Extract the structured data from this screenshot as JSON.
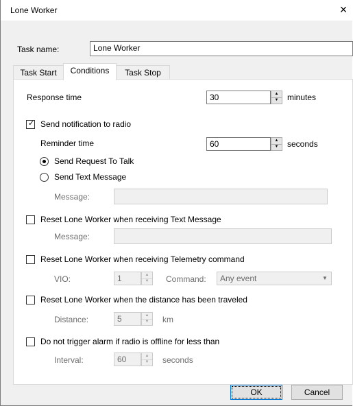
{
  "window": {
    "title": "Lone Worker",
    "close_glyph": "×"
  },
  "task_name": {
    "label": "Task name:",
    "value": "Lone Worker"
  },
  "tabs": [
    {
      "label": "Task Start",
      "active": false
    },
    {
      "label": "Conditions",
      "active": true
    },
    {
      "label": "Task Stop",
      "active": false
    }
  ],
  "conditions": {
    "response_time": {
      "label": "Response time",
      "value": "30",
      "unit": "minutes"
    },
    "send_notification": {
      "label": "Send notification to radio",
      "checked": true
    },
    "reminder_time": {
      "label": "Reminder time",
      "value": "60",
      "unit": "seconds"
    },
    "send_request_to_talk": {
      "label": "Send Request To Talk",
      "selected": true
    },
    "send_text_message": {
      "label": "Send Text Message",
      "selected": false
    },
    "message1": {
      "label": "Message:",
      "value": ""
    },
    "reset_text_message": {
      "label": "Reset Lone Worker when receiving Text Message",
      "checked": false
    },
    "message2": {
      "label": "Message:",
      "value": ""
    },
    "reset_telemetry": {
      "label": "Reset Lone Worker when receiving Telemetry command",
      "checked": false
    },
    "vio": {
      "label": "VIO:",
      "value": "1"
    },
    "command": {
      "label": "Command:",
      "value": "Any event"
    },
    "reset_distance": {
      "label": "Reset Lone Worker when the distance has been traveled",
      "checked": false
    },
    "distance": {
      "label": "Distance:",
      "value": "5",
      "unit": "km"
    },
    "offline": {
      "label": "Do not trigger alarm if radio is offline for less than",
      "checked": false
    },
    "interval": {
      "label": "Interval:",
      "value": "60",
      "unit": "seconds"
    }
  },
  "buttons": {
    "ok": "OK",
    "cancel": "Cancel"
  },
  "icons": {
    "spin_up": "▲",
    "spin_down": "▼",
    "dropdown": "▼",
    "check": "✓"
  }
}
